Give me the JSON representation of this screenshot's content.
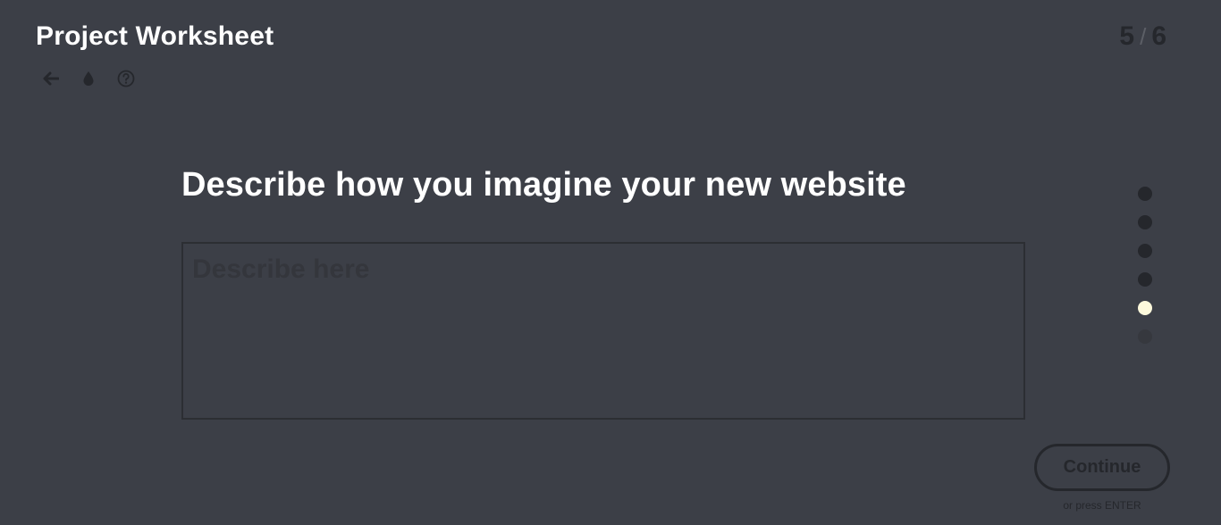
{
  "header": {
    "title": "Project Worksheet",
    "toolbar": [
      {
        "icon": "back-arrow-icon",
        "label": "Back"
      },
      {
        "icon": "droplet-icon",
        "label": "Theme"
      },
      {
        "icon": "help-icon",
        "label": "Help"
      }
    ]
  },
  "progress": {
    "current": "5",
    "separator": "/",
    "total": "6"
  },
  "question": {
    "title": "Describe how you imagine your new website",
    "input_value": "",
    "input_placeholder": "Describe here"
  },
  "nav_dots": [
    {
      "step": 1,
      "state": "completed",
      "color": "#25272c"
    },
    {
      "step": 2,
      "state": "completed",
      "color": "#25272c"
    },
    {
      "step": 3,
      "state": "completed",
      "color": "#25272c"
    },
    {
      "step": 4,
      "state": "completed",
      "color": "#25272c"
    },
    {
      "step": 5,
      "state": "current",
      "color": "#fdf9dc"
    },
    {
      "step": 6,
      "state": "upcoming",
      "color": "#36383e"
    }
  ],
  "actions": {
    "continue_label": "Continue",
    "enter_hint": "or press ENTER"
  },
  "colors": {
    "background": "#3c3f47",
    "text_primary": "#ffffff",
    "text_dim": "#25272c",
    "accent_current": "#fdf9dc"
  }
}
